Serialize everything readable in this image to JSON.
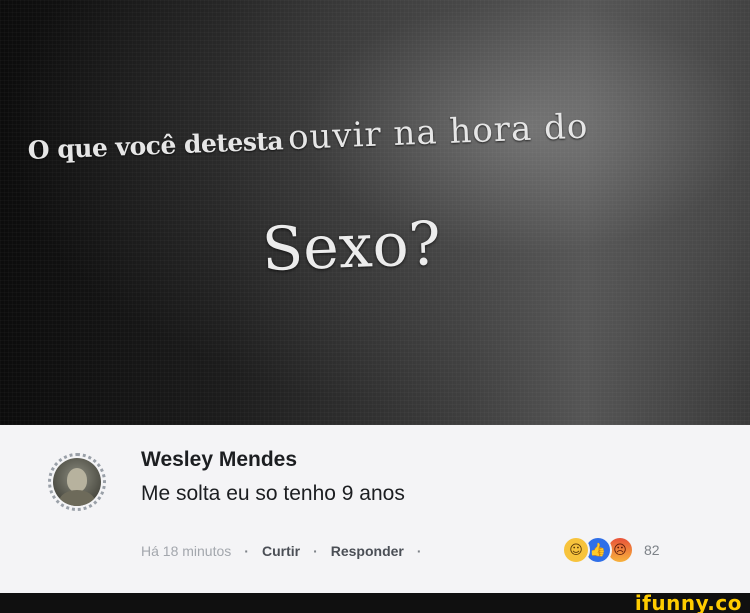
{
  "meme": {
    "headline_start": "O que você detesta",
    "headline_end": "ouvir na hora do",
    "subline": "Sexo?"
  },
  "comment": {
    "author": "Wesley Mendes",
    "text": "Me solta eu so tenho 9 anos",
    "timestamp": "Há 18 minutos",
    "separator": "·",
    "like_label": "Curtir",
    "reply_label": "Responder",
    "reaction_icons": [
      "haha-reaction-icon",
      "like-reaction-icon",
      "angry-reaction-icon"
    ],
    "reaction_count": "82"
  },
  "watermark": "ifunny.co",
  "colors": {
    "comment_background": "#f4f4f6",
    "watermark": "#ffcc00",
    "like_blue": "#2f6fe8"
  }
}
